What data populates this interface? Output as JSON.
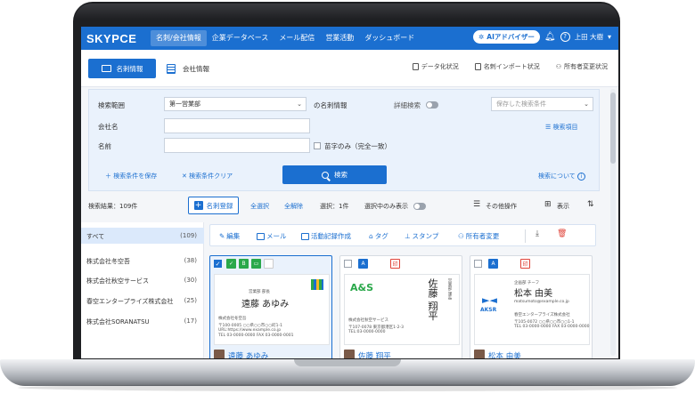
{
  "nav": {
    "logo": "SKYPCE",
    "items": [
      "名刺/会社情報",
      "企業データベース",
      "メール配信",
      "営業活動",
      "ダッシュボード"
    ],
    "ai_button": "AIアドバイザー",
    "user": "上田 大樹"
  },
  "subnav": {
    "tab_cards": "名刺情報",
    "tab_company": "会社情報",
    "links": [
      "データ化状況",
      "名刺インポート状況",
      "所有者変更状況"
    ]
  },
  "search": {
    "scope_label": "検索範囲",
    "scope_value": "第一営業部",
    "scope_suffix": "の名刺情報",
    "detail_label": "詳細検索",
    "saved_placeholder": "保存した検索条件",
    "company_label": "会社名",
    "name_label": "名前",
    "surname_only": "苗字のみ（完全一致）",
    "search_items": "検索項目",
    "save_conditions": "＋ 検索条件を保存",
    "clear_conditions": "✕ 検索条件クリア",
    "search_button": "検索",
    "about_search": "検索について"
  },
  "results": {
    "count": "検索結果：109件",
    "register": "名刺登録",
    "select_all": "全選択",
    "deselect_all": "全解除",
    "selected": "選択：1件",
    "show_selected": "選択中のみ表示",
    "other_ops": "その他操作",
    "display": "表示"
  },
  "sidebar": {
    "items": [
      {
        "name": "すべて",
        "count": "(109)"
      },
      {
        "name": "株式会社冬空吾",
        "count": "(38)"
      },
      {
        "name": "株式会社秋空サービス",
        "count": "(30)"
      },
      {
        "name": "春空エンタープライズ株式会社",
        "count": "(25)"
      },
      {
        "name": "株式会社SORANATSU",
        "count": "(17)"
      }
    ]
  },
  "actions": {
    "edit": "編集",
    "mail": "メール",
    "activity": "活動記録作成",
    "tag": "タグ",
    "stamp": "スタンプ",
    "owner": "所有者変更"
  },
  "cards": [
    {
      "bc_title": "営業部 部長",
      "bc_name": "遠藤 あゆみ",
      "bc_company": "株式会社冬空吾",
      "bc_line1": "〒100-0005 ○○県○○市○○町1-1",
      "bc_line2": "URL:https://www.example.co.jp",
      "bc_line3": "TEL 03-0000-0000 FAX 03-0000-0001",
      "badge1": "B",
      "foot_name": "遠藤 あゆみ"
    },
    {
      "bc_logo": "A&S",
      "bc_name": "佐藤 翔平",
      "bc_title": "営業部 課長",
      "bc_company": "株式会社秋空サービス",
      "bc_line1": "〒107-0078 東京都港区1-2-3",
      "bc_line2": "TEL:03-0000-0000",
      "badge1": "A",
      "foot_name": "佐藤 翔平"
    },
    {
      "bc_logo": "AKSR",
      "bc_title": "企画部 チーフ",
      "bc_name": "松本 由美",
      "bc_mail": "matsumoto@example.co.jp",
      "bc_company": "春空エンタープライズ株式会社",
      "bc_line1": "〒105-0072 ○○県○○市○○1-1",
      "bc_line2": "TEL 03-0000-0000 FAX 03-0000-0000",
      "badge1": "A",
      "foot_name": "松本 由美"
    }
  ],
  "colors": {
    "primary": "#1b6fd0",
    "panel": "#eaf2fc",
    "green_badge": "#2aa84a",
    "trash": "#e0443a"
  }
}
